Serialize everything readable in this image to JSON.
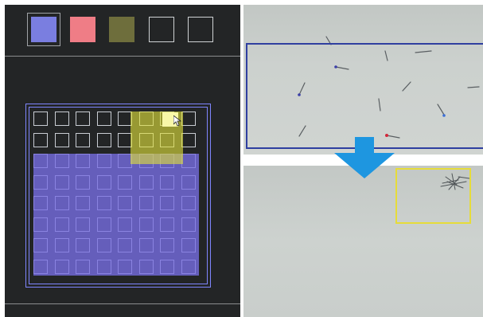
{
  "colors": {
    "panel_bg": "#232526",
    "roi_blue": "#2f3fa0",
    "roi_yellow": "#e6dc3a",
    "arrow": "#1e96e0",
    "swatch_purple": "#7a7ee0",
    "swatch_red": "#ef7d86",
    "swatch_olive": "#6e6e3c"
  },
  "palette": [
    {
      "name": "purple",
      "color": "#7a7ee0",
      "selected": true
    },
    {
      "name": "red",
      "color": "#ef7d86",
      "selected": false
    },
    {
      "name": "olive",
      "color": "#6e6e3c",
      "selected": false
    },
    {
      "name": "empty-1",
      "color": null,
      "selected": false
    },
    {
      "name": "empty-2",
      "color": null,
      "selected": false
    }
  ],
  "grid": {
    "rows": 8,
    "cols": 8,
    "regions": [
      {
        "name": "blue-region",
        "color": "#7a7ee0",
        "rows": [
          2,
          7
        ],
        "cols": [
          0,
          7
        ]
      },
      {
        "name": "yellow-region",
        "color": "#e1e13c",
        "rows": [
          0,
          2
        ],
        "cols": [
          4,
          6
        ]
      }
    ],
    "hover_cell": {
      "row": 0,
      "col": 6
    }
  },
  "icons": {
    "cursor": "mouse-pointer-icon",
    "arrow": "arrow-down-icon"
  }
}
